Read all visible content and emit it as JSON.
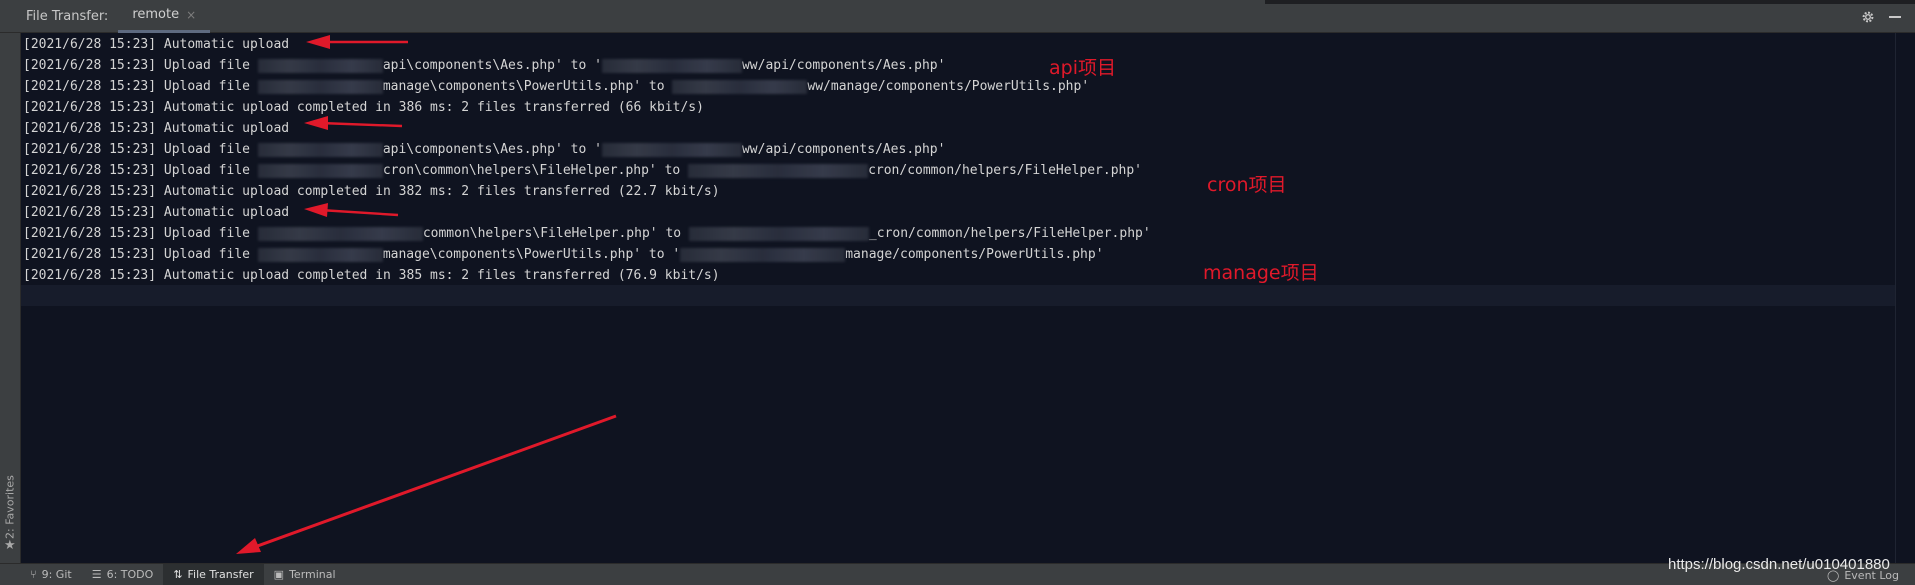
{
  "header": {
    "title": "File Transfer:",
    "tab_label": "remote",
    "tab_close": "×"
  },
  "console": {
    "lines": [
      {
        "prefix": "[2021/6/28 15:23] Automatic upload",
        "mid": "",
        "suffix": ""
      },
      {
        "prefix": "[2021/6/28 15:23] Upload file ",
        "mid": "api\\components\\Aes.php' to '",
        "suffix": "ww/api/components/Aes.php'"
      },
      {
        "prefix": "[2021/6/28 15:23] Upload file ",
        "mid": "manage\\components\\PowerUtils.php' to ",
        "suffix": "ww/manage/components/PowerUtils.php'"
      },
      {
        "prefix": "[2021/6/28 15:23] Automatic upload completed in 386 ms: 2 files transferred (66 kbit/s)",
        "mid": "",
        "suffix": ""
      },
      {
        "prefix": "[2021/6/28 15:23] Automatic upload",
        "mid": "",
        "suffix": ""
      },
      {
        "prefix": "[2021/6/28 15:23] Upload file ",
        "mid": "api\\components\\Aes.php' to '",
        "suffix": "ww/api/components/Aes.php'"
      },
      {
        "prefix": "[2021/6/28 15:23] Upload file ",
        "mid": "cron\\common\\helpers\\FileHelper.php' to ",
        "suffix": "cron/common/helpers/FileHelper.php'"
      },
      {
        "prefix": "[2021/6/28 15:23] Automatic upload completed in 382 ms: 2 files transferred (22.7 kbit/s)",
        "mid": "",
        "suffix": ""
      },
      {
        "prefix": "[2021/6/28 15:23] Automatic upload",
        "mid": "",
        "suffix": ""
      },
      {
        "prefix": "[2021/6/28 15:23] Upload file ",
        "mid": "common\\helpers\\FileHelper.php' to ",
        "suffix": "_cron/common/helpers/FileHelper.php'"
      },
      {
        "prefix": "[2021/6/28 15:23] Upload file ",
        "mid": "manage\\components\\PowerUtils.php' to '",
        "suffix": "manage/components/PowerUtils.php'"
      },
      {
        "prefix": "[2021/6/28 15:23] Automatic upload completed in 385 ms: 2 files transferred (76.9 kbit/s)",
        "mid": "",
        "suffix": ""
      }
    ]
  },
  "annotations": {
    "api": "api项目",
    "cron": "cron项目",
    "manage": "manage项目"
  },
  "left_stripe": {
    "favorites": "2: Favorites"
  },
  "bottom_bar": {
    "git": "9: Git",
    "todo": "6: TODO",
    "file_transfer": "File Transfer",
    "terminal": "Terminal",
    "event_log": "Event Log"
  },
  "watermark": "https://blog.csdn.net/u010401880",
  "colors": {
    "console_bg": "#0f1320",
    "annotation_red": "#e0192a",
    "toolbar_bg": "#3c3f41"
  }
}
